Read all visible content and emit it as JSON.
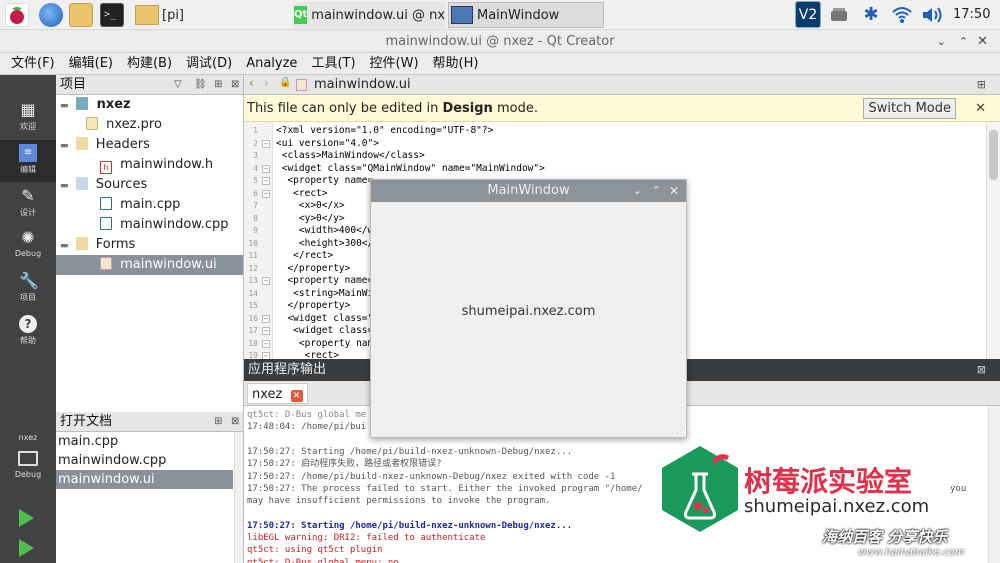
{
  "taskbar": {
    "tasks": [
      {
        "label": "[pi]"
      },
      {
        "label": "mainwindow.ui @ nx..."
      },
      {
        "label": "MainWindow"
      }
    ],
    "clock": "17:50",
    "vnc_label": "V2"
  },
  "window": {
    "title": "mainwindow.ui @ nxez - Qt Creator"
  },
  "menu": [
    "文件(F)",
    "编辑(E)",
    "构建(B)",
    "调试(D)",
    "Analyze",
    "工具(T)",
    "控件(W)",
    "帮助(H)"
  ],
  "modes": [
    {
      "label": "欢迎",
      "icon": "grid-icon"
    },
    {
      "label": "编辑",
      "icon": "document-icon"
    },
    {
      "label": "设计",
      "icon": "pencil-icon"
    },
    {
      "label": "Debug",
      "icon": "bug-icon"
    },
    {
      "label": "项目",
      "icon": "wrench-icon"
    },
    {
      "label": "帮助",
      "icon": "help-icon"
    }
  ],
  "kit": {
    "project": "nxez",
    "config": "Debug"
  },
  "project_pane": {
    "title": "项目",
    "tree": [
      {
        "label": "nxez",
        "depth": 0
      },
      {
        "label": "nxez.pro",
        "depth": 1
      },
      {
        "label": "Headers",
        "depth": 1
      },
      {
        "label": "mainwindow.h",
        "depth": 2
      },
      {
        "label": "Sources",
        "depth": 1
      },
      {
        "label": "main.cpp",
        "depth": 2
      },
      {
        "label": "mainwindow.cpp",
        "depth": 2
      },
      {
        "label": "Forms",
        "depth": 1
      },
      {
        "label": "mainwindow.ui",
        "depth": 2
      }
    ]
  },
  "open_docs": {
    "title": "打开文档",
    "items": [
      "main.cpp",
      "mainwindow.cpp",
      "mainwindow.ui"
    ]
  },
  "editor": {
    "file_tab": "mainwindow.ui",
    "info_prefix": "This file can only be edited in ",
    "info_bold": "Design",
    "info_suffix": " mode.",
    "switch_label": "Switch Mode",
    "lines": [
      "<?xml version=\"1.0\" encoding=\"UTF-8\"?>",
      "<ui version=\"4.0\">",
      " <class>MainWindow</class>",
      " <widget class=\"QMainWindow\" name=\"MainWindow\">",
      "  <property name=",
      "   <rect>",
      "    <x>0</x>",
      "    <y>0</y>",
      "    <width>400</w",
      "    <height>300</",
      "   </rect>",
      "  </property>",
      "  <property name=",
      "   <string>MainWi",
      "  </property>",
      "  <widget class=\"",
      "   <widget class=",
      "    <property nam",
      "     <rect>"
    ]
  },
  "output": {
    "title": "应用程序输出",
    "tab": "nxez",
    "lines": [
      {
        "text": "qt5ct: D-Bus global me",
        "color": "#888888",
        "bold": false
      },
      {
        "text": "17:48:04: /home/pi/bui",
        "color": "#555555",
        "bold": false
      },
      {
        "text": "",
        "color": "#000000",
        "bold": false
      },
      {
        "text": "17:50:27: Starting /home/pi/build-nxez-unknown-Debug/nxez...",
        "color": "#555555",
        "bold": false
      },
      {
        "text": "17:50:27: 启动程序失败，路径或者权限错误?",
        "color": "#555555",
        "bold": false
      },
      {
        "text": "17:50:27: /home/pi/build-nxez-unknown-Debug/nxez exited with code -1",
        "color": "#555555",
        "bold": false
      },
      {
        "text": "17:50:27: The process failed to start. Either the invoked program \"/home/",
        "color": "#555555",
        "bold": false
      },
      {
        "text": "may have insufficient permissions to invoke the program.",
        "color": "#555555",
        "bold": false
      },
      {
        "text": "",
        "color": "#000000",
        "bold": false
      },
      {
        "text": "17:50:27: Starting /home/pi/build-nxez-unknown-Debug/nxez...",
        "color": "#1a2a9a",
        "bold": true
      },
      {
        "text": "libEGL warning: DRI2: failed to authenticate",
        "color": "#cc2020",
        "bold": false
      },
      {
        "text": "qt5ct: using qt5ct plugin",
        "color": "#cc2020",
        "bold": false
      },
      {
        "text": "qt5ct: D-Bus global menu: no",
        "color": "#cc2020",
        "bold": false
      }
    ],
    "line_tail_you": "you"
  },
  "main_window": {
    "title": "MainWindow",
    "label": "shumeipai.nxez.com"
  },
  "watermark": {
    "brand": "树莓派实验室",
    "url": "shumeipai.nxez.com",
    "slogan": "海纳百客 分享快乐",
    "site": "www.hainabaike.com"
  },
  "colors": {
    "mode_bar": "#404244",
    "selection": "#8a9198",
    "info_bar": "#fffad6",
    "accent_green": "#1a9a5a"
  }
}
